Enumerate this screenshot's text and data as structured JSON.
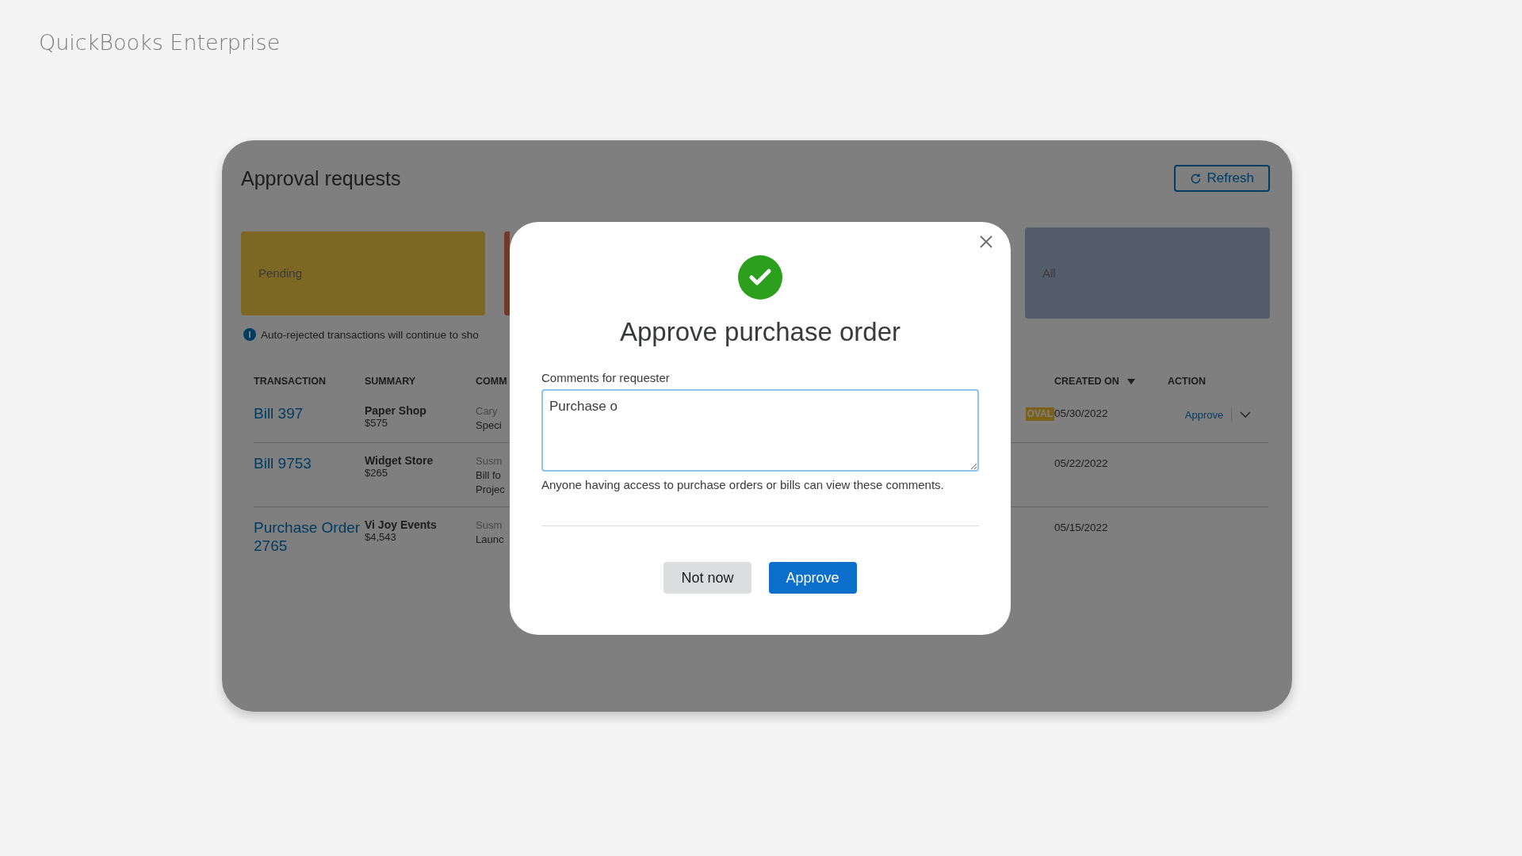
{
  "app_title": "QuickBooks Enterprise",
  "panel": {
    "title": "Approval requests",
    "refresh_button": "Refresh",
    "status_cards_left": [
      {
        "label": "Pending",
        "color": "#7c6723"
      },
      {
        "color": "#70392a"
      }
    ],
    "status_cards_right": [
      {
        "label": "All",
        "color": "#535d6a"
      }
    ],
    "info_text": "Auto-rejected transactions will continue to sho",
    "table": {
      "columns": [
        {
          "label": "TRANSACTION"
        },
        {
          "label": "SUMMARY"
        },
        {
          "label": "COMM"
        },
        {
          "label": "CREATED ON",
          "sorted": true
        },
        {
          "label": "ACTION"
        }
      ],
      "rows": [
        {
          "transaction": "Bill 397",
          "vendor": "Paper Shop",
          "amount": "$575",
          "comment_author": "Cary",
          "comment": [
            "Speci"
          ],
          "badge": "OVAL",
          "created_on": "05/30/2022",
          "action": "Approve"
        },
        {
          "transaction": "Bill 9753",
          "vendor": "Widget Store",
          "amount": "$265",
          "comment_author": "Susm",
          "comment": [
            "Bill fo",
            "Projec"
          ],
          "created_on": "05/22/2022"
        },
        {
          "transaction": "Purchase Order 2765",
          "vendor": "Vi Joy Events",
          "amount": "$4,543",
          "comment_author": "Susm",
          "comment": [
            "Launc"
          ],
          "created_on": "05/15/2022"
        }
      ]
    }
  },
  "dialog": {
    "title": "Approve purchase order",
    "field_label": "Comments for requester",
    "field_value": "Purchase o",
    "hint": "Anyone having access to purchase orders or bills can view these comments.",
    "buttons": [
      {
        "label": "Not now",
        "kind": "secondary"
      },
      {
        "label": "Approve",
        "kind": "primary"
      }
    ]
  }
}
